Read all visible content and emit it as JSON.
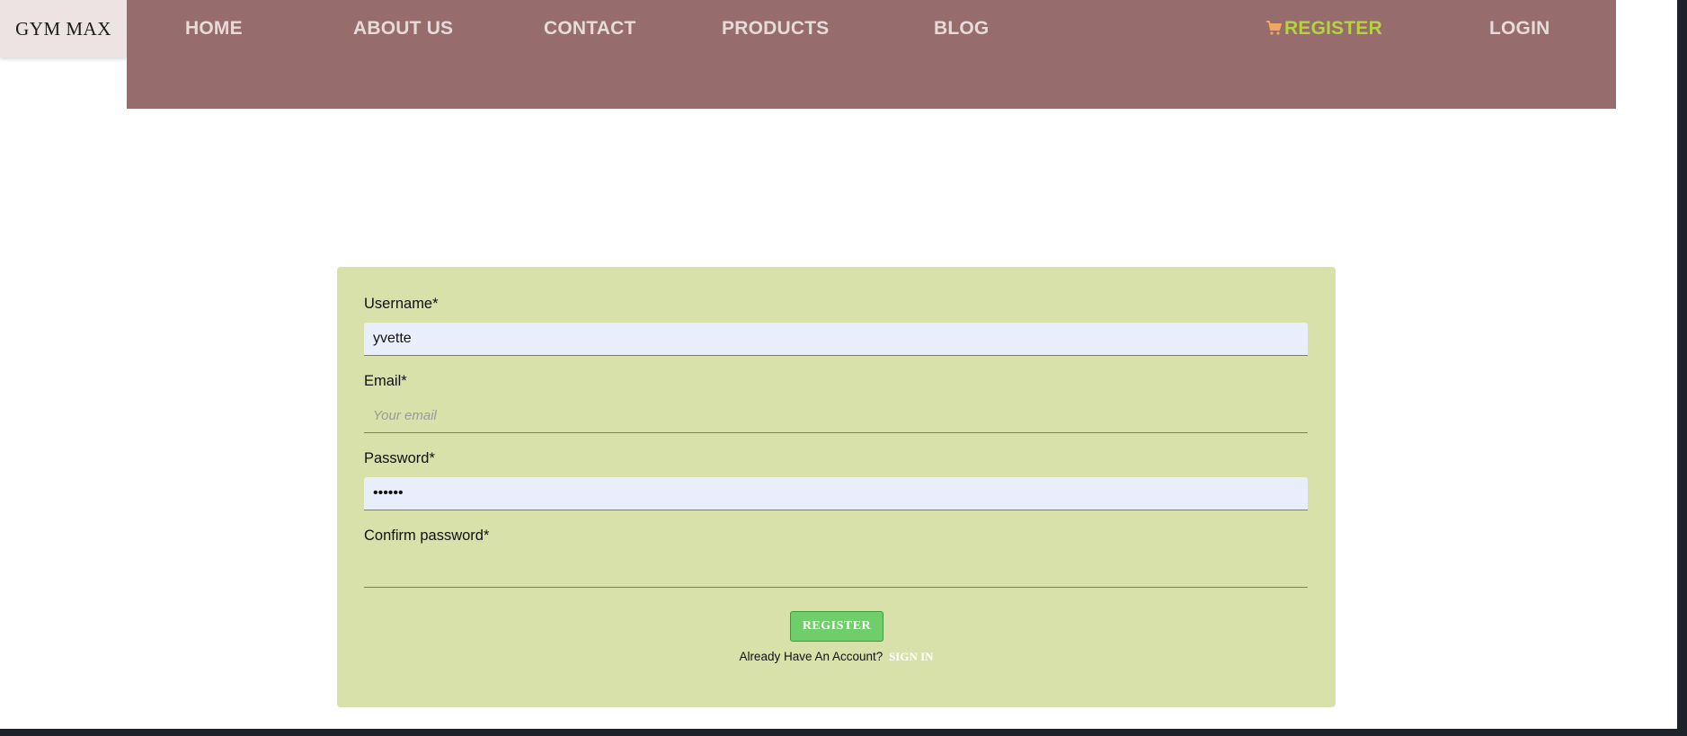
{
  "brand": {
    "logo_text": "GYM MAX"
  },
  "nav": {
    "home": "HOME",
    "about": "ABOUT US",
    "contact": "CONTACT",
    "products": "PRODUCTS",
    "blog": "BLOG",
    "cart_icon": "shopping-cart-icon",
    "register": "REGISTER",
    "login": "LOGIN"
  },
  "form": {
    "username_label": "Username*",
    "username_value": "yvette",
    "email_label": "Email*",
    "email_placeholder": "Your email",
    "password_label": "Password*",
    "password_value": "••••••",
    "confirm_label": "Confirm password*",
    "confirm_value": "",
    "submit_label": "REGISTER",
    "account_prompt": "Already Have An Account?",
    "signin_label": "SIGN IN"
  },
  "colors": {
    "nav_background": "#976c6d",
    "nav_text": "#e7dada",
    "nav_active": "#b5d33d",
    "cart_icon": "#f0a860",
    "form_background": "#d7e1a9",
    "button_background": "#6fcd6a",
    "input_underline": "#c45a5a",
    "autofill_background": "#e8eefc"
  }
}
